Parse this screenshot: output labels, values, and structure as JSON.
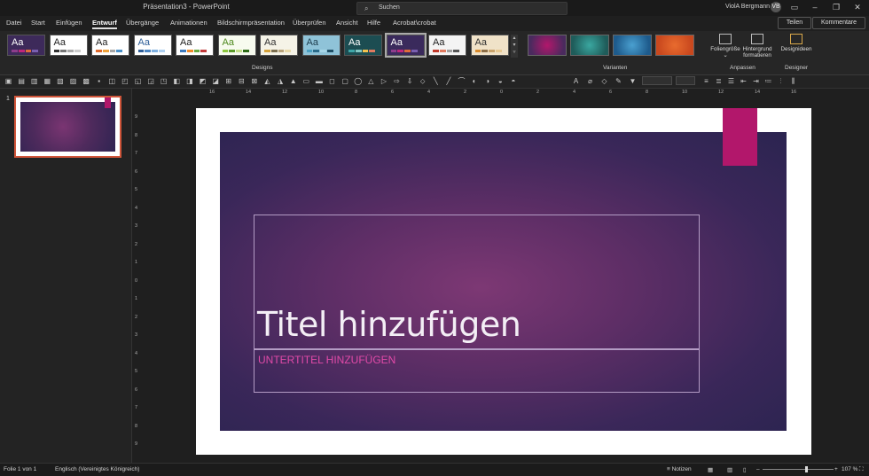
{
  "titlebar": {
    "doc_title": "Präsentation3 - PowerPoint",
    "search_placeholder": "Suchen",
    "user_name": "ViolA Bergmann",
    "avatar_initials": "VB"
  },
  "menu_tabs": [
    "Datei",
    "Start",
    "Einfügen",
    "Entwurf",
    "Übergänge",
    "Animationen",
    "Bildschirmpräsentation",
    "Überprüfen",
    "Ansicht",
    "Hilfe",
    "Acrobat\\crobat"
  ],
  "active_tab": "Entwurf",
  "share_label": "Teilen",
  "comments_label": "Kommentare",
  "ribbon": {
    "designs_label": "Designs",
    "theme_glyph": "Aa",
    "variants_label": "Varianten",
    "customize_label": "Anpassen",
    "designer_label": "Designer",
    "slide_size_label": "Foliengröße",
    "format_bg_line1": "Hintergrund",
    "format_bg_line2": "formatieren",
    "design_ideas_label": "Designideen",
    "themes": [
      {
        "bg": "#3d2a5a",
        "fg": "#ffffff",
        "bars": [
          "#8e3d8c",
          "#c0267b",
          "#e06c3a",
          "#7a5fb0"
        ]
      },
      {
        "bg": "#ffffff",
        "fg": "#222222",
        "bars": [
          "#333333",
          "#777777",
          "#aaaaaa",
          "#cccccc"
        ]
      },
      {
        "bg": "#ffffff",
        "fg": "#222222",
        "bars": [
          "#e06a2c",
          "#f0a33b",
          "#a7a7a7",
          "#4a90c8"
        ]
      },
      {
        "bg": "#ffffff",
        "fg": "#2f5f99",
        "bars": [
          "#2f5f99",
          "#4e87c4",
          "#7fb0e0",
          "#aed0f0"
        ]
      },
      {
        "bg": "#ffffff",
        "fg": "#222222",
        "bars": [
          "#3e7bbf",
          "#f08a2a",
          "#66a93f",
          "#c23b3b"
        ]
      },
      {
        "bg": "#f7fbef",
        "fg": "#4f8a1f",
        "bars": [
          "#8cc63e",
          "#5b9b2a",
          "#c4e08a",
          "#2e6b17"
        ]
      },
      {
        "bg": "#f5f3e7",
        "fg": "#333333",
        "bars": [
          "#d4a23b",
          "#7c6f4f",
          "#b8a37a",
          "#e8d9a8"
        ]
      },
      {
        "bg": "#8fc3d8",
        "fg": "#1e3d4d",
        "bars": [
          "#4aa0c2",
          "#2a6b8a",
          "#a6d6e8",
          "#1f4f66"
        ]
      },
      {
        "bg": "#1c4d52",
        "fg": "#ffffff",
        "bars": [
          "#3fa7a8",
          "#82c7c3",
          "#f2c14e",
          "#e07a5f"
        ]
      },
      {
        "bg": "#3a2a5c",
        "fg": "#ffffff",
        "bars": [
          "#8e3d8c",
          "#c0267b",
          "#e06c3a",
          "#7a5fb0"
        ]
      },
      {
        "bg": "#f4f4f4",
        "fg": "#222222",
        "bars": [
          "#c0392b",
          "#e07a5f",
          "#a0a0a0",
          "#555555"
        ]
      },
      {
        "bg": "#f0e2c8",
        "fg": "#333333",
        "bars": [
          "#d98a2b",
          "#8d6e46",
          "#c9a36b",
          "#e8c991"
        ]
      }
    ],
    "variants": [
      {
        "bg": "#4a2a5e",
        "accent": "#b2176b"
      },
      {
        "bg": "#1f5c5a",
        "accent": "#3aa7a0"
      },
      {
        "bg": "#1e5b8c",
        "accent": "#4aa0d0"
      },
      {
        "bg": "#c9481e",
        "accent": "#e86b2e"
      }
    ]
  },
  "thumbnail": {
    "number": "1"
  },
  "rulers": {
    "h_ticks": [
      "16",
      "14",
      "12",
      "10",
      "8",
      "6",
      "4",
      "2",
      "0",
      "2",
      "4",
      "6",
      "8",
      "10",
      "12",
      "14",
      "16"
    ],
    "v_ticks": [
      "9",
      "8",
      "7",
      "6",
      "5",
      "4",
      "3",
      "2",
      "1",
      "0",
      "1",
      "2",
      "3",
      "4",
      "5",
      "6",
      "7",
      "8",
      "9"
    ]
  },
  "slide": {
    "title": "Titel hinzufügen",
    "subtitle": "UNTERTITEL HINZUFÜGEN",
    "accent_color": "#b2176b"
  },
  "status": {
    "slide_counter": "Folie 1 von 1",
    "language": "Englisch (Vereinigtes Königreich)",
    "notes_label": "Notizen",
    "zoom": "107 %",
    "zoom_fraction": 0.6
  }
}
